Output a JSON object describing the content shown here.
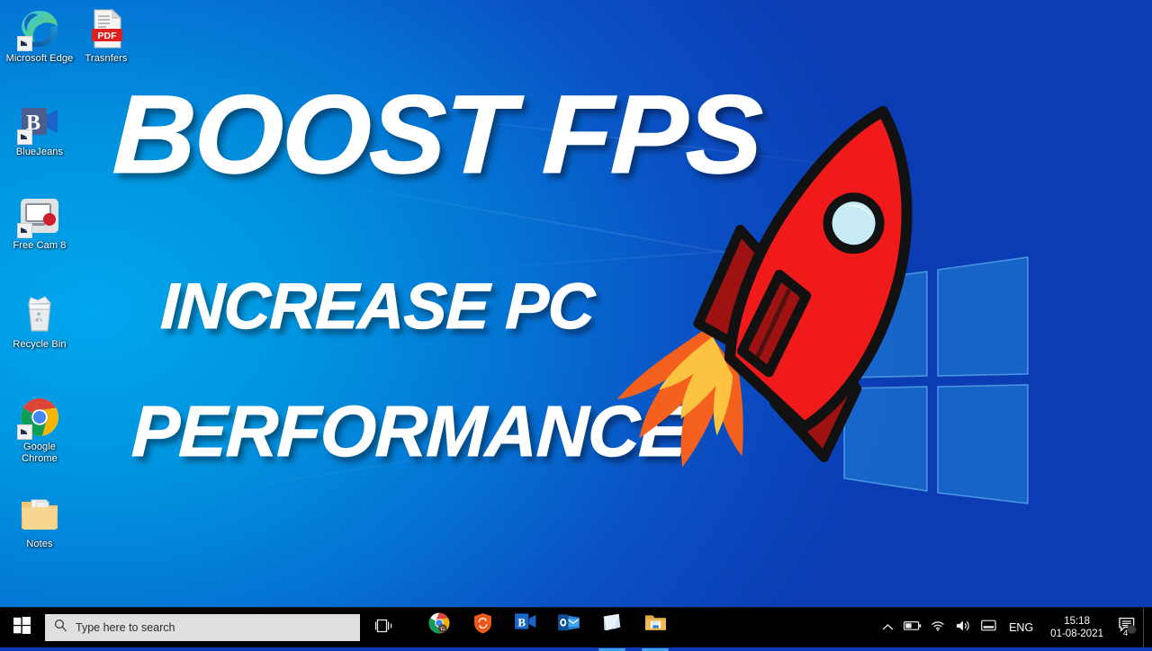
{
  "wallpaper": {
    "name": "windows-10-hero-blue",
    "color_left": "#00a0e9",
    "color_right": "#0b3ab4",
    "logo": "windows-logo-watermark"
  },
  "thumbnail": {
    "title": "BOOST FPS",
    "subtitle_line1": "INCREASE PC",
    "subtitle_line2": "PERFORMANCE",
    "text_color": "#ffffff",
    "artwork": "red-rocket-with-flames",
    "rocket_colors": {
      "body": "#f01a1a",
      "fin": "#9e1212",
      "outline": "#111111",
      "window": "#c8ecf5",
      "flame_outer": "#f4601e",
      "flame_inner": "#fcc340"
    }
  },
  "desktop_icons": [
    {
      "label": "Microsoft Edge",
      "icon": "edge-icon",
      "shortcut": true
    },
    {
      "label": "Trasnfers",
      "icon": "pdf-file-icon",
      "shortcut": false
    },
    {
      "label": "BlueJeans",
      "icon": "bluejeans-icon",
      "shortcut": true
    },
    {
      "label": "Free Cam 8",
      "icon": "free-cam-icon",
      "shortcut": true
    },
    {
      "label": "Recycle Bin",
      "icon": "recycle-bin-icon",
      "shortcut": false
    },
    {
      "label": "Google Chrome",
      "icon": "chrome-icon",
      "shortcut": true
    },
    {
      "label": "Notes",
      "icon": "folder-icon",
      "shortcut": false
    }
  ],
  "taskbar": {
    "start_button": "windows-start-icon",
    "search": {
      "placeholder": "Type here to search",
      "icon": "search-icon"
    },
    "task_view": "task-view-icon",
    "apps": [
      {
        "name": "Google Chrome",
        "icon": "chrome-icon",
        "active": false
      },
      {
        "name": "Shield Security App",
        "icon": "shield-icon",
        "active": false
      },
      {
        "name": "BlueJeans",
        "icon": "bluejeans-icon",
        "active": false
      },
      {
        "name": "Microsoft Outlook",
        "icon": "outlook-icon",
        "active": false
      },
      {
        "name": "Sticky Notes",
        "icon": "sticky-notes-icon",
        "active": true
      },
      {
        "name": "File Explorer",
        "icon": "file-explorer-icon",
        "active": true
      }
    ],
    "tray": {
      "icons": [
        {
          "name": "show-hidden-icons",
          "glyph": "chevron-up-icon"
        },
        {
          "name": "battery",
          "glyph": "battery-icon"
        },
        {
          "name": "network",
          "glyph": "wifi-icon"
        },
        {
          "name": "volume",
          "glyph": "speaker-icon"
        },
        {
          "name": "display-settings",
          "glyph": "monitor-icon"
        }
      ],
      "language": "ENG",
      "time": "15:18",
      "date": "01-08-2021",
      "notification": {
        "icon": "action-center-icon",
        "badge": "4"
      }
    }
  }
}
